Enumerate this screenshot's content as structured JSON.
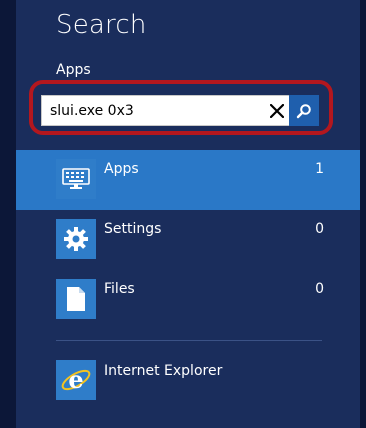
{
  "search": {
    "title": "Search",
    "scope_label": "Apps",
    "query": "slui.exe 0x3"
  },
  "categories": [
    {
      "label": "Apps",
      "count": "1",
      "icon": "keyboard-icon",
      "selected": true
    },
    {
      "label": "Settings",
      "count": "0",
      "icon": "gear-icon",
      "selected": false
    },
    {
      "label": "Files",
      "count": "0",
      "icon": "document-icon",
      "selected": false
    }
  ],
  "results": [
    {
      "label": "Internet Explorer",
      "icon": "internet-explorer-icon"
    }
  ],
  "colors": {
    "background": "#1a2d5c",
    "selected": "#2a78c7",
    "tile": "#2f7dc9",
    "highlight": "#b3171e",
    "search_button": "#1f5fad"
  }
}
